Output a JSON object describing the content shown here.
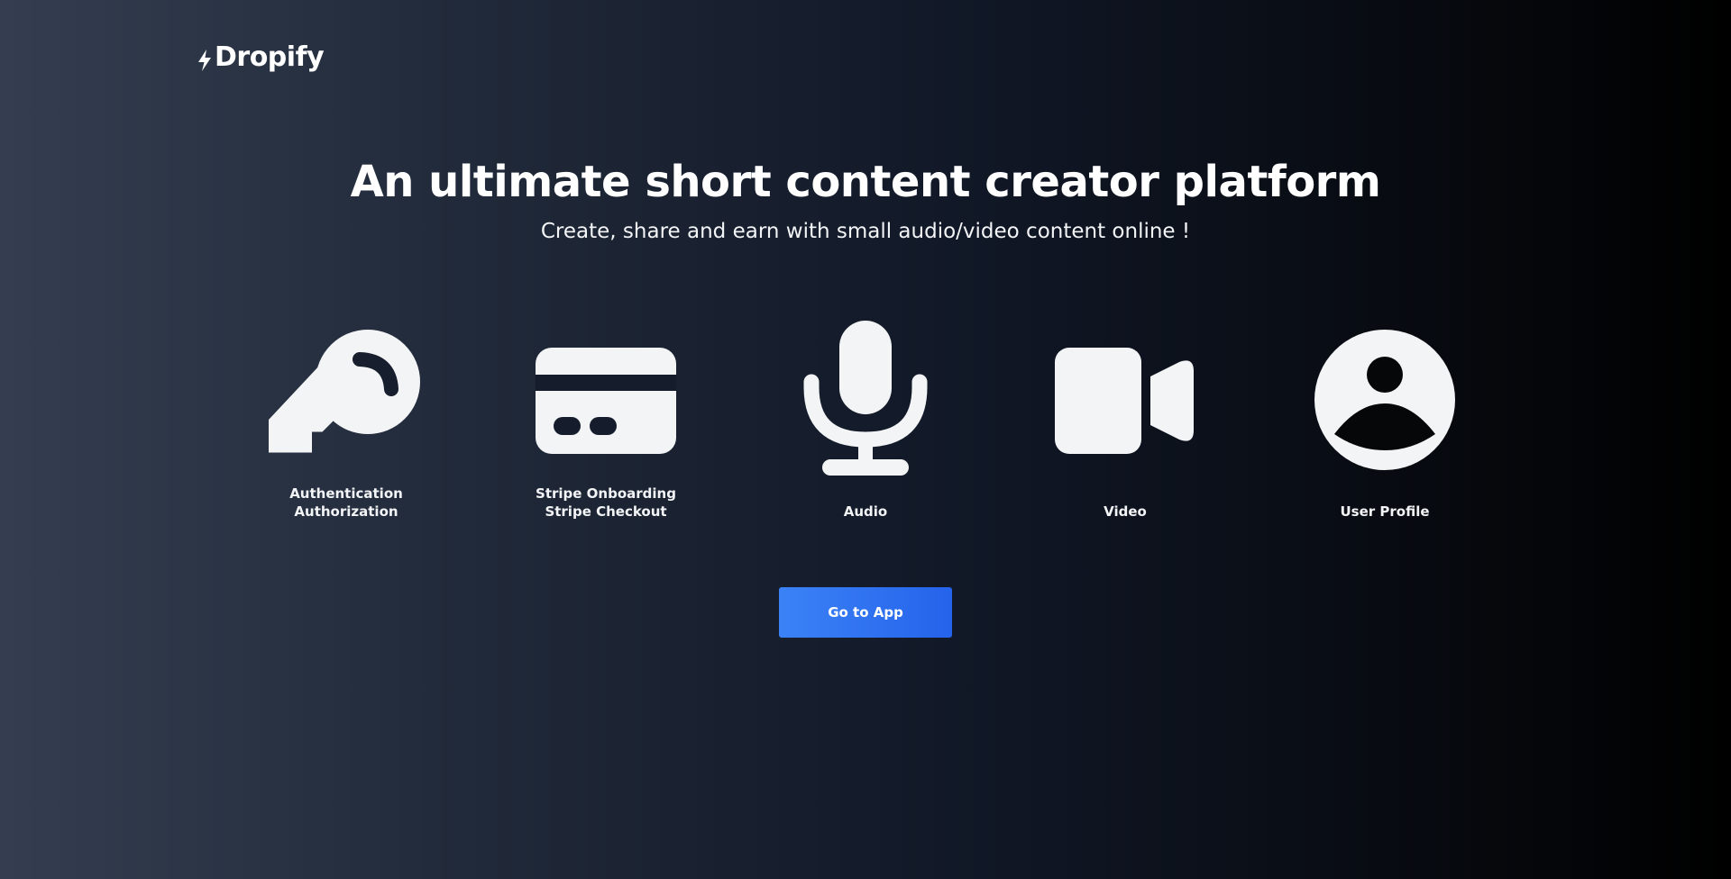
{
  "brand": {
    "name": "Dropify",
    "icon": "lightning-bolt-icon"
  },
  "hero": {
    "title": "An ultimate short content creator platform",
    "subtitle": "Create, share and earn with small audio/video content online !"
  },
  "features": [
    {
      "icon": "key-icon",
      "lines": [
        "Authentication",
        "Authorization"
      ]
    },
    {
      "icon": "credit-card-icon",
      "lines": [
        "Stripe Onboarding",
        "Stripe Checkout"
      ]
    },
    {
      "icon": "microphone-icon",
      "lines": [
        "",
        "Audio"
      ]
    },
    {
      "icon": "video-camera-icon",
      "lines": [
        "",
        "Video"
      ]
    },
    {
      "icon": "user-circle-icon",
      "lines": [
        "",
        "User Profile"
      ]
    }
  ],
  "cta": {
    "label": "Go to App"
  },
  "colors": {
    "icon": "#f3f4f6",
    "accent": "#3b82f6",
    "accent_dark": "#2563eb"
  }
}
